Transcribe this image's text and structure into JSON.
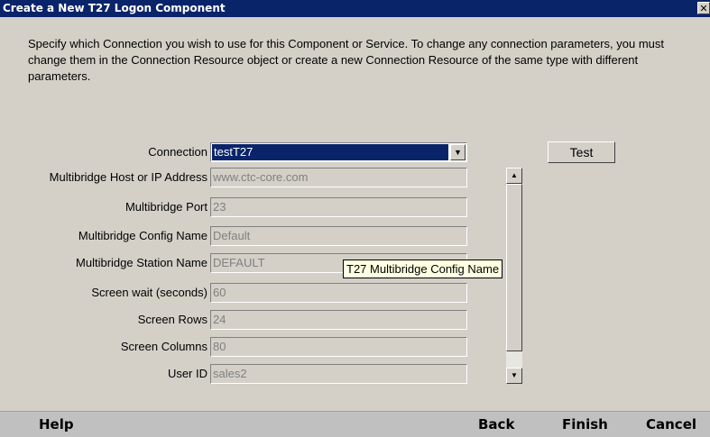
{
  "window": {
    "title": "Create a New T27 Logon Component",
    "close_glyph": "✕"
  },
  "description": "Specify which Connection you wish to use for this Component or Service.  To change any connection parameters, you must change them in the Connection Resource object or create a new Connection Resource of the same type with different parameters.",
  "connection": {
    "label": "Connection",
    "selected": "testT27"
  },
  "test_button": "Test",
  "fields": [
    {
      "label": "Multibridge Host or IP Address",
      "value": "www.ctc-core.com"
    },
    {
      "label": "Multibridge Port",
      "value": "23"
    },
    {
      "label": "Multibridge Config Name",
      "value": "Default"
    },
    {
      "label": "Multibridge Station Name",
      "value": "DEFAULT"
    },
    {
      "label": "Screen wait (seconds)",
      "value": "60"
    },
    {
      "label": "Screen Rows",
      "value": "24"
    },
    {
      "label": "Screen Columns",
      "value": "80"
    },
    {
      "label": "User ID",
      "value": "sales2"
    }
  ],
  "tooltip": "T27 Multibridge Config Name",
  "footer": {
    "help": "Help",
    "back": "Back",
    "finish": "Finish",
    "cancel": "Cancel"
  }
}
